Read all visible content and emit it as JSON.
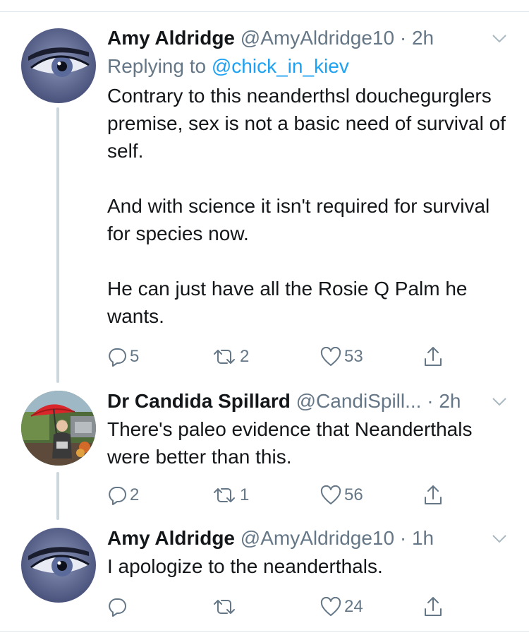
{
  "tweets": [
    {
      "name": "Amy Aldridge",
      "handle": "@AmyAldridge10",
      "dot": "·",
      "time": "2h",
      "reply_prefix": "Replying to ",
      "reply_to": "@chick_in_kiev",
      "paragraphs": [
        "Contrary to this neanderthsl douchegurglers premise, sex is not a basic need of survival of self.",
        "And with science it isn't required for survival for species now.",
        "He can just have all the Rosie Q Palm he wants."
      ],
      "replies": "5",
      "retweets": "2",
      "likes": "53"
    },
    {
      "name": "Dr Candida Spillard",
      "handle": "@CandiSpill...",
      "dot": "·",
      "time": "2h",
      "paragraphs": [
        "There's paleo evidence that Neanderthals were better than this."
      ],
      "replies": "2",
      "retweets": "1",
      "likes": "56"
    },
    {
      "name": "Amy Aldridge",
      "handle": "@AmyAldridge10",
      "dot": "·",
      "time": "1h",
      "paragraphs": [
        "I apologize to the neanderthals."
      ],
      "replies": "",
      "retweets": "",
      "likes": "24"
    }
  ],
  "colors": {
    "text": "#14171a",
    "secondary": "#657786",
    "link": "#1da1f2",
    "thread_line": "#ccd6dd",
    "divider": "#e1e8ed"
  },
  "icons": [
    "chevron-down-icon",
    "reply-icon",
    "retweet-icon",
    "heart-icon",
    "share-icon"
  ]
}
